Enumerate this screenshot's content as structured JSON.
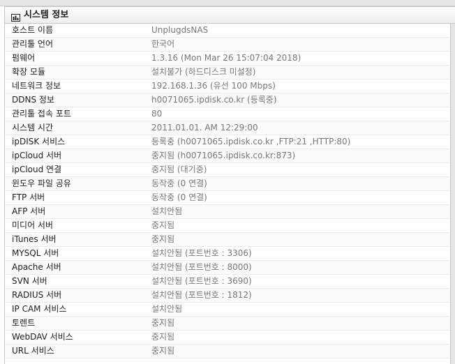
{
  "panel": {
    "title": "시스템 정보",
    "icon": "bar-chart-icon"
  },
  "rows": [
    {
      "label": "호스트 이름",
      "value": "UnplugdsNAS"
    },
    {
      "label": "관리툴 언어",
      "value": "한국어"
    },
    {
      "label": "펌웨어",
      "value": "1.3.16 (Mon Mar 26 15:07:04 2018)"
    },
    {
      "label": "확장 모듈",
      "value": "설치불가 (하드디스크 미설정)"
    },
    {
      "label": "네트워크 정보",
      "value": "192.168.1.36 (유선 100 Mbps)"
    },
    {
      "label": "DDNS 정보",
      "value": "h0071065.ipdisk.co.kr (등록중)"
    },
    {
      "label": "관리툴 접속 포트",
      "value": "80"
    },
    {
      "label": "시스템 시간",
      "value": "2011.01.01. AM 12:29:00"
    },
    {
      "label": "ipDISK 서비스",
      "value": "등록중 (h0071065.ipdisk.co.kr ,FTP:21 ,HTTP:80)"
    },
    {
      "label": "ipCloud 서버",
      "value": "중지됨 (h0071065.ipdisk.co.kr:873)"
    },
    {
      "label": "ipCloud 연결",
      "value": "중지됨 (대기중)"
    },
    {
      "label": "윈도우 파일 공유",
      "value": "동작중 (0 연결)"
    },
    {
      "label": "FTP 서버",
      "value": "동작중 (0 연결)"
    },
    {
      "label": "AFP 서버",
      "value": "설치안됨"
    },
    {
      "label": "미디어 서버",
      "value": "중지됨"
    },
    {
      "label": "iTunes 서버",
      "value": "중지됨"
    },
    {
      "label": "MYSQL 서버",
      "value": "설치안됨 (포트번호 : 3306)"
    },
    {
      "label": "Apache 서버",
      "value": "설치안됨 (포트번호 : 8000)"
    },
    {
      "label": "SVN 서버",
      "value": "설치안됨 (포트번호 : 3690)"
    },
    {
      "label": "RADIUS 서버",
      "value": "설치안됨 (포트번호 : 1812)"
    },
    {
      "label": "IP CAM 서비스",
      "value": "설치안됨"
    },
    {
      "label": "토렌트",
      "value": "중지됨"
    },
    {
      "label": "WebDAV 서비스",
      "value": "중지됨"
    },
    {
      "label": "URL 서비스",
      "value": "중지됨"
    }
  ]
}
